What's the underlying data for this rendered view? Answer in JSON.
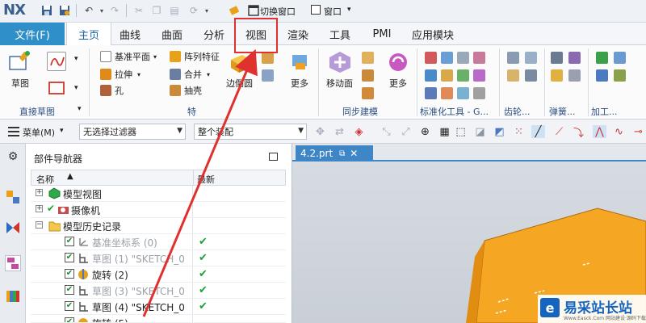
{
  "app": {
    "logo": "NX"
  },
  "quick_access": {
    "switch_window_label": "切换窗口",
    "window_label": "窗口",
    "dropdown_glyph": "▾"
  },
  "menu": {
    "file": "文件(F)",
    "tabs": [
      "主页",
      "曲线",
      "曲面",
      "分析",
      "视图",
      "渲染",
      "工具",
      "PMI",
      "应用模块"
    ],
    "active_tab": "主页",
    "highlighted_tab": "视图"
  },
  "ribbon": {
    "sketch_label": "草图",
    "direct_sketch_group": "直接草图",
    "datum_plane": "基准平面",
    "pattern_feature": "阵列特征",
    "extrude": "拉伸",
    "unite": "合并",
    "hole": "孔",
    "shell": "抽壳",
    "edge_blend": "边倒圆",
    "more": "更多",
    "feature_group": "特",
    "move_face": "移动面",
    "more2": "更多",
    "sync_group": "同步建模",
    "std_tools_group": "标准化工具 - G...",
    "gear_group": "齿轮...",
    "spring_group": "弹簧...",
    "machining_group": "加工..."
  },
  "selection_bar": {
    "menu_label": "菜单(M)",
    "filter_value": "无选择过滤器",
    "scope_value": "整个装配"
  },
  "navigator": {
    "title": "部件导航器",
    "col_name": "名称",
    "col_latest": "最新",
    "sort_glyph": "▲",
    "rows": [
      {
        "label": "模型视图",
        "expand": "+",
        "check": "",
        "tick": ""
      },
      {
        "label": "摄像机",
        "expand": "+",
        "check": "✔",
        "tick": ""
      },
      {
        "label": "模型历史记录",
        "expand": "−",
        "check": "",
        "tick": ""
      },
      {
        "label": "基准坐标系 (0)",
        "expand": "",
        "check": "✔",
        "tick": "✔",
        "dim": true
      },
      {
        "label": "草图 (1) \"SKETCH_0",
        "expand": "",
        "check": "✔",
        "tick": "✔",
        "dim": true
      },
      {
        "label": "旋转 (2)",
        "expand": "",
        "check": "✔",
        "tick": "✔"
      },
      {
        "label": "草图 (3) \"SKETCH_0",
        "expand": "",
        "check": "✔",
        "tick": "✔",
        "dim": true
      },
      {
        "label": "草图 (4) \"SKETCH_0",
        "expand": "",
        "check": "✔",
        "tick": "✔"
      },
      {
        "label": "旋转 (5)",
        "expand": "",
        "check": "✔",
        "tick": "✔"
      }
    ]
  },
  "viewport": {
    "tab_label": "4.2.prt"
  },
  "watermark": {
    "title": "易采站长站",
    "subtitle": "Www.Easck.Com  网站建设·源码下载"
  },
  "colors": {
    "accent": "#2e8fc9",
    "model": "#f0a020",
    "highlight": "#e0312e"
  }
}
